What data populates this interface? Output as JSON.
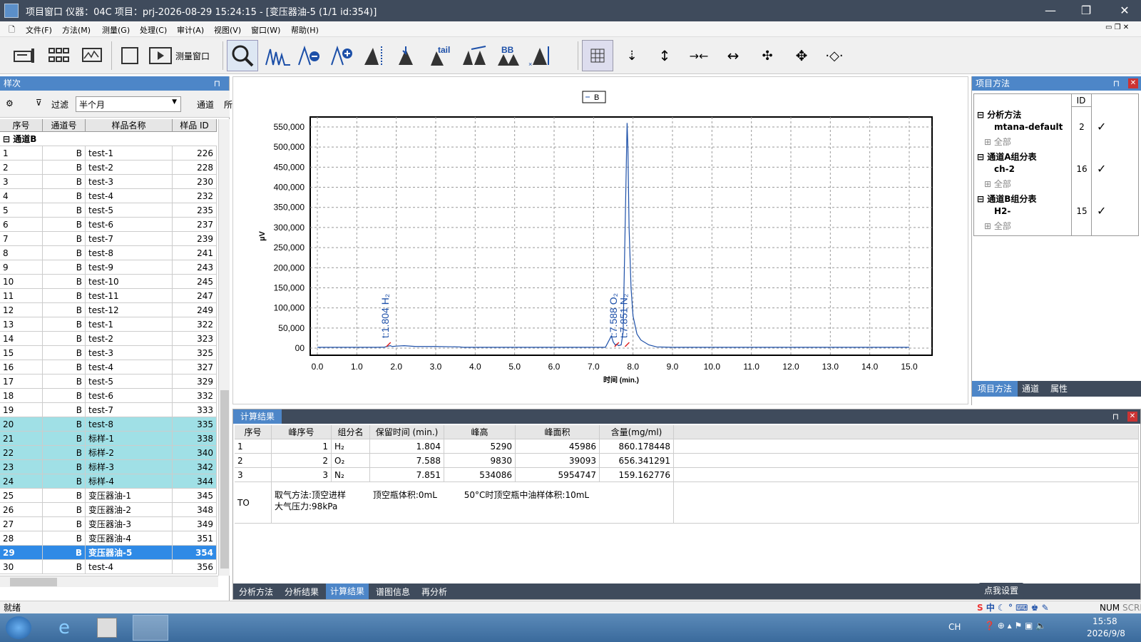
{
  "window": {
    "title": "项目窗口 仪器：04C 项目：prj-2026-08-29 15:24:15 - [变压器油-5 (1/1 id:354)]",
    "minimize": "—",
    "restore": "❐",
    "close": "✕"
  },
  "menu": [
    "文件(F)",
    "方法(M)",
    "测量(G)",
    "处理(C)",
    "审计(A)",
    "视图(V)",
    "窗口(W)",
    "帮助(H)"
  ],
  "toolbar": {
    "measure_window_label": "测量窗口",
    "peak_tail_label": "tail",
    "peak_bb_label": "BB"
  },
  "left_panel": {
    "title": "样次",
    "filter_label": "过滤",
    "filter_value": "半个月",
    "channel_label": "通道",
    "channel_cut": "所",
    "columns": [
      "序号",
      "通道号",
      "样品名称",
      "样品 ID"
    ],
    "group": "通道B",
    "rows": [
      {
        "seq": "1",
        "ch": "B",
        "name": "test-1",
        "id": "226",
        "state": ""
      },
      {
        "seq": "2",
        "ch": "B",
        "name": "test-2",
        "id": "228",
        "state": ""
      },
      {
        "seq": "3",
        "ch": "B",
        "name": "test-3",
        "id": "230",
        "state": ""
      },
      {
        "seq": "4",
        "ch": "B",
        "name": "test-4",
        "id": "232",
        "state": ""
      },
      {
        "seq": "5",
        "ch": "B",
        "name": "test-5",
        "id": "235",
        "state": ""
      },
      {
        "seq": "6",
        "ch": "B",
        "name": "test-6",
        "id": "237",
        "state": ""
      },
      {
        "seq": "7",
        "ch": "B",
        "name": "test-7",
        "id": "239",
        "state": ""
      },
      {
        "seq": "8",
        "ch": "B",
        "name": "test-8",
        "id": "241",
        "state": ""
      },
      {
        "seq": "9",
        "ch": "B",
        "name": "test-9",
        "id": "243",
        "state": ""
      },
      {
        "seq": "10",
        "ch": "B",
        "name": "test-10",
        "id": "245",
        "state": ""
      },
      {
        "seq": "11",
        "ch": "B",
        "name": "test-11",
        "id": "247",
        "state": ""
      },
      {
        "seq": "12",
        "ch": "B",
        "name": "test-12",
        "id": "249",
        "state": ""
      },
      {
        "seq": "13",
        "ch": "B",
        "name": "test-1",
        "id": "322",
        "state": ""
      },
      {
        "seq": "14",
        "ch": "B",
        "name": "test-2",
        "id": "323",
        "state": ""
      },
      {
        "seq": "15",
        "ch": "B",
        "name": "test-3",
        "id": "325",
        "state": ""
      },
      {
        "seq": "16",
        "ch": "B",
        "name": "test-4",
        "id": "327",
        "state": ""
      },
      {
        "seq": "17",
        "ch": "B",
        "name": "test-5",
        "id": "329",
        "state": ""
      },
      {
        "seq": "18",
        "ch": "B",
        "name": "test-6",
        "id": "332",
        "state": ""
      },
      {
        "seq": "19",
        "ch": "B",
        "name": "test-7",
        "id": "333",
        "state": ""
      },
      {
        "seq": "20",
        "ch": "B",
        "name": "test-8",
        "id": "335",
        "state": "hl"
      },
      {
        "seq": "21",
        "ch": "B",
        "name": "标样-1",
        "id": "338",
        "state": "hl"
      },
      {
        "seq": "22",
        "ch": "B",
        "name": "标样-2",
        "id": "340",
        "state": "hl"
      },
      {
        "seq": "23",
        "ch": "B",
        "name": "标样-3",
        "id": "342",
        "state": "hl"
      },
      {
        "seq": "24",
        "ch": "B",
        "name": "标样-4",
        "id": "344",
        "state": "hl"
      },
      {
        "seq": "25",
        "ch": "B",
        "name": "变压器油-1",
        "id": "345",
        "state": ""
      },
      {
        "seq": "26",
        "ch": "B",
        "name": "变压器油-2",
        "id": "348",
        "state": ""
      },
      {
        "seq": "27",
        "ch": "B",
        "name": "变压器油-3",
        "id": "349",
        "state": ""
      },
      {
        "seq": "28",
        "ch": "B",
        "name": "变压器油-4",
        "id": "351",
        "state": ""
      },
      {
        "seq": "29",
        "ch": "B",
        "name": "变压器油-5",
        "id": "354",
        "state": "sel"
      },
      {
        "seq": "30",
        "ch": "B",
        "name": "test-4",
        "id": "356",
        "state": ""
      }
    ]
  },
  "chart_data": {
    "type": "line",
    "legend": "B",
    "xlabel": "时间 (min.)",
    "ylabel": "µV",
    "xlim": [
      0,
      15.0
    ],
    "ylim": [
      0,
      550000
    ],
    "xticks": [
      "0.0",
      "1.0",
      "2.0",
      "3.0",
      "4.0",
      "5.0",
      "6.0",
      "7.0",
      "8.0",
      "9.0",
      "10.0",
      "11.0",
      "12.0",
      "13.0",
      "14.0",
      "15.0"
    ],
    "yticks": [
      "00",
      "50,000",
      "100,000",
      "150,000",
      "200,000",
      "250,000",
      "300,000",
      "350,000",
      "400,000",
      "450,000",
      "500,000",
      "550,000"
    ],
    "series": [
      {
        "name": "B",
        "x": [
          0,
          1.5,
          1.7,
          1.8,
          1.85,
          1.9,
          2.0,
          2.2,
          2.5,
          3.0,
          3.6,
          3.7,
          5,
          7.3,
          7.45,
          7.5,
          7.55,
          7.59,
          7.63,
          7.7,
          7.75,
          7.8,
          7.85,
          7.87,
          7.9,
          7.95,
          8.0,
          8.1,
          8.2,
          8.4,
          8.6,
          9,
          10,
          12,
          15.0
        ],
        "y": [
          2000,
          2000,
          2500,
          5000,
          6000,
          4000,
          5000,
          6000,
          4000,
          4000,
          3000,
          2000,
          2000,
          2000,
          30000,
          15000,
          8000,
          10000,
          6000,
          8000,
          40000,
          300000,
          560000,
          500000,
          300000,
          150000,
          80000,
          35000,
          20000,
          8000,
          3000,
          2000,
          2000,
          2000,
          2000
        ]
      }
    ],
    "peaks": [
      {
        "x": 1.804,
        "label": "t:1.804 H₂"
      },
      {
        "x": 7.588,
        "label": "t:7.588 O₂"
      },
      {
        "x": 7.851,
        "label": "t:7.851 N₂"
      }
    ]
  },
  "right_panel": {
    "title": "项目方法",
    "id_col": "ID",
    "groups": [
      {
        "label": "分析方法",
        "item": "mtana-default",
        "id": "2",
        "all": "全部"
      },
      {
        "label": "通道A组分表",
        "item": "ch-2",
        "id": "16",
        "all": "全部"
      },
      {
        "label": "通道B组分表",
        "item": "H2-",
        "id": "15",
        "all": "全部"
      }
    ],
    "tabs": [
      "项目方法",
      "通道",
      "属性"
    ]
  },
  "results": {
    "title": "计算结果",
    "columns": [
      "序号",
      "峰序号",
      "组分名",
      "保留时间 (min.)",
      "峰高",
      "峰面积",
      "含量(mg/ml)"
    ],
    "rows": [
      {
        "seq": "1",
        "peak": "1",
        "name": "H₂",
        "rt": "1.804",
        "height": "5290",
        "area": "45986",
        "content": "860.178448"
      },
      {
        "seq": "2",
        "peak": "2",
        "name": "O₂",
        "rt": "7.588",
        "height": "9830",
        "area": "39093",
        "content": "656.341291"
      },
      {
        "seq": "3",
        "peak": "3",
        "name": "N₂",
        "rt": "7.851",
        "height": "534086",
        "area": "5954747",
        "content": "159.162776"
      }
    ],
    "note_label": "TO",
    "note_line1a": "取气方法:顶空进样",
    "note_line1b": "顶空瓶体积:0mL",
    "note_line1c": "50°C时顶空瓶中油样体积:10mL",
    "note_line2": "大气压力:98kPa",
    "tabs": [
      "分析方法",
      "分析结果",
      "计算结果",
      "谱图信息",
      "再分析"
    ]
  },
  "status": {
    "text": "就绪",
    "ime_tip": "点我设置",
    "ime_lang": "中",
    "num": "NUM",
    "scrl": "SCRL"
  },
  "taskbar": {
    "lang": "CH",
    "time": "15:58",
    "date": "2026/9/8"
  }
}
